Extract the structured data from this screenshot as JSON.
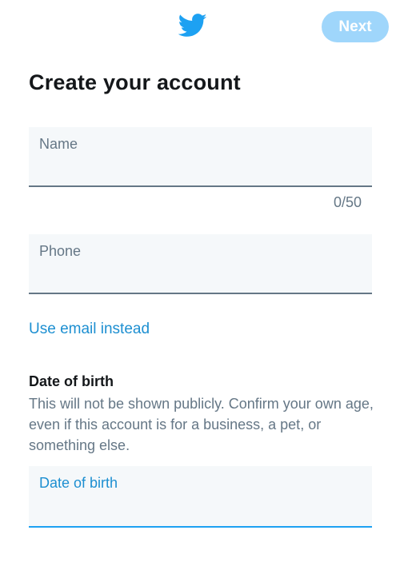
{
  "header": {
    "logo_icon": "twitter-bird-icon",
    "next_label": "Next",
    "accent_color": "#1da1f2",
    "next_button_color": "#9fd6fb"
  },
  "title": "Create your account",
  "form": {
    "name": {
      "label": "Name",
      "value": "",
      "counter": "0/50"
    },
    "phone": {
      "label": "Phone",
      "value": ""
    },
    "use_email_link": "Use email instead",
    "dob": {
      "heading": "Date of birth",
      "description": "This will not be shown publicly. Confirm your own age, even if this account is for a business, a pet, or something else.",
      "label": "Date of birth",
      "value": "",
      "focused": true
    }
  }
}
